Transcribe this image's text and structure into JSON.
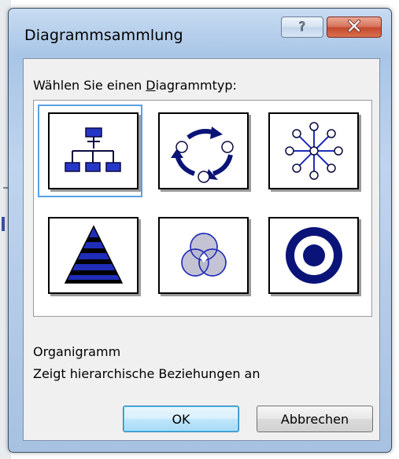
{
  "window": {
    "title": "Diagrammsammlung",
    "help_icon": "question-mark-icon",
    "close_icon": "close-x-icon"
  },
  "prompt": {
    "before": "Wählen Sie einen ",
    "mnemonic": "D",
    "after": "iagrammtyp:"
  },
  "diagram_types": [
    {
      "id": "organization-chart",
      "icon": "org-chart-icon",
      "selected": true
    },
    {
      "id": "cycle",
      "icon": "cycle-diagram-icon",
      "selected": false
    },
    {
      "id": "radial",
      "icon": "radial-diagram-icon",
      "selected": false
    },
    {
      "id": "pyramid",
      "icon": "pyramid-diagram-icon",
      "selected": false
    },
    {
      "id": "venn",
      "icon": "venn-diagram-icon",
      "selected": false
    },
    {
      "id": "target",
      "icon": "target-diagram-icon",
      "selected": false
    }
  ],
  "description": {
    "name": "Organigramm",
    "text": "Zeigt hierarchische Beziehungen an"
  },
  "buttons": {
    "ok": "OK",
    "cancel": "Abbrechen"
  },
  "colors": {
    "diagram_blue": "#1f2db8",
    "diagram_navy": "#0a1478",
    "selection": "#5aa0e6"
  }
}
